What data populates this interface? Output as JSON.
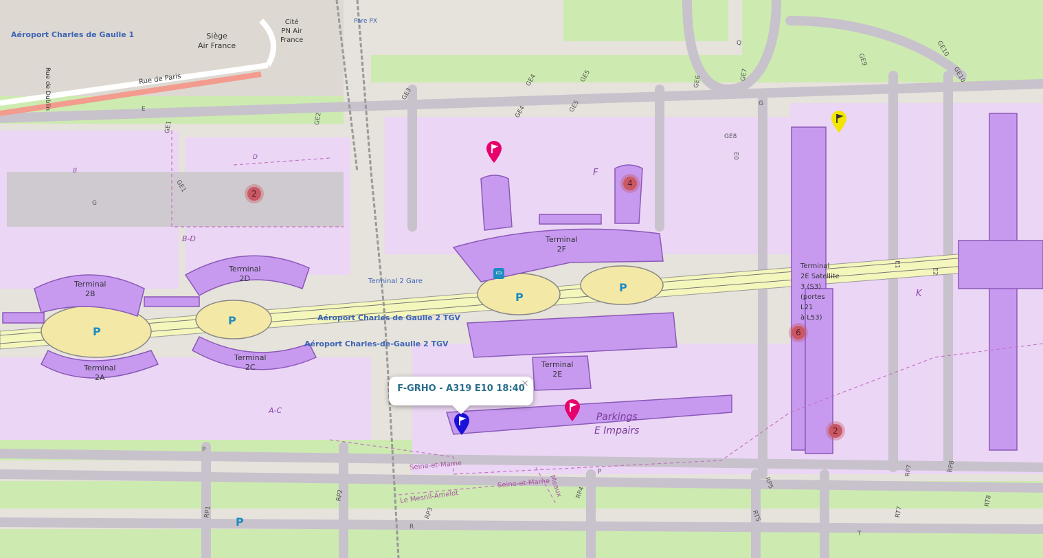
{
  "map": {
    "place_labels": {
      "cdg1": "Aéroport Charles de Gaulle 1",
      "siege": "Siège\nAir France",
      "cite": "Cité\nPN Air\nFrance",
      "parepx": "Pare PX",
      "rue_paris": "Rue de Paris",
      "rue_dublin": "Rue de Dublin",
      "t2_gare": "Terminal 2 Gare",
      "tgv1": "Aéroport Charles de Gaulle 2 TGV",
      "tgv2": "Aéroport Charles-de-Gaulle 2 TGV"
    },
    "terminals": {
      "t2a": "Terminal\n2A",
      "t2b": "Terminal\n2B",
      "t2c": "Terminal\n2C",
      "t2d": "Terminal\n2D",
      "t2e": "Terminal\n2E",
      "t2f": "Terminal\n2F",
      "t2e_sat": "Terminal\n2E Satellite\n3 (S3)\n(portes\nL21\nà L53)"
    },
    "areas": {
      "b": "B",
      "d": "D",
      "bd": "B-D",
      "ac": "A-C",
      "f": "F",
      "k": "K",
      "g": "G",
      "parkings": "Parkings\nE Impairs"
    },
    "taxiways": {
      "ge1": "GE1",
      "ge1b": "GE1",
      "ge2": "GE2",
      "ge3": "GE3",
      "ge4": "GE4",
      "ge4b": "GE4",
      "ge5": "GE5",
      "ge5b": "GE5",
      "ge6": "GE6",
      "ge7": "GE7",
      "ge8": "GE8",
      "ge9": "GE9",
      "ge10": "GE10",
      "ge10b": "GE10",
      "e": "E",
      "g": "G",
      "q": "Q",
      "e0": "E0",
      "e1": "E1",
      "e2": "E2",
      "p": "P",
      "p2": "P",
      "r": "R",
      "t": "T",
      "rp1": "RP1",
      "rp2": "RP2",
      "rp3": "RP3",
      "rp4": "RP4",
      "rp5": "RP5",
      "rp7": "RP7",
      "rp8": "RP8",
      "rt5": "RT5",
      "rt7": "RT7",
      "rt8": "RT8"
    },
    "admin": {
      "seine1": "Seine-et-Marne",
      "seine2": "Seine-et-Marne",
      "mesnil": "Le Mesnil-Amelot",
      "meaux": "Meaux"
    },
    "parking_sign": "P",
    "clusters": [
      {
        "count": "2"
      },
      {
        "count": "4"
      },
      {
        "count": "6"
      },
      {
        "count": "2"
      }
    ],
    "markers": [
      {
        "color": "#e8006c",
        "icon": "flag-icon"
      },
      {
        "color": "#e8006c",
        "icon": "flag-icon"
      },
      {
        "color": "#f2e600",
        "icon": "flag-icon"
      },
      {
        "color": "#1a10d8",
        "icon": "flag-icon"
      }
    ],
    "popup": {
      "text": "F-GRHO - A319 E10 18:40",
      "close": "×"
    }
  }
}
